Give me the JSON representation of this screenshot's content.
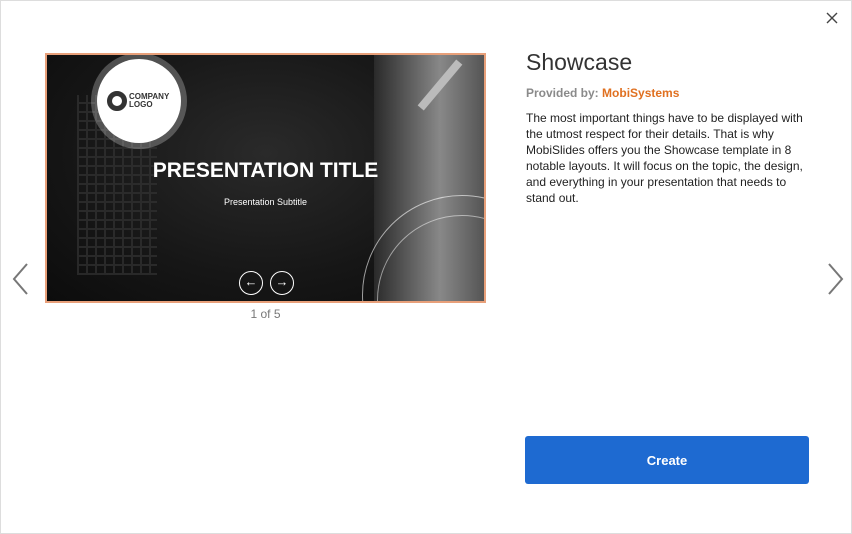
{
  "template": {
    "name": "Showcase",
    "provided_by_label": "Provided by:",
    "provider": "MobiSystems",
    "description": "The most important things have to be displayed with the utmost respect for their details. That is why MobiSlides offers you the Showcase template in 8 notable layouts. It will focus on the topic, the design, and everything in your presentation that needs to stand out."
  },
  "preview": {
    "logo_text": "COMPANY LOGO",
    "slide_title": "PRESENTATION TITLE",
    "slide_subtitle": "Presentation Subtitle",
    "pager": "1 of 5"
  },
  "actions": {
    "create_label": "Create"
  },
  "colors": {
    "accent": "#1e6ad1",
    "provider": "#e07020",
    "preview_border": "#e8a07a"
  }
}
